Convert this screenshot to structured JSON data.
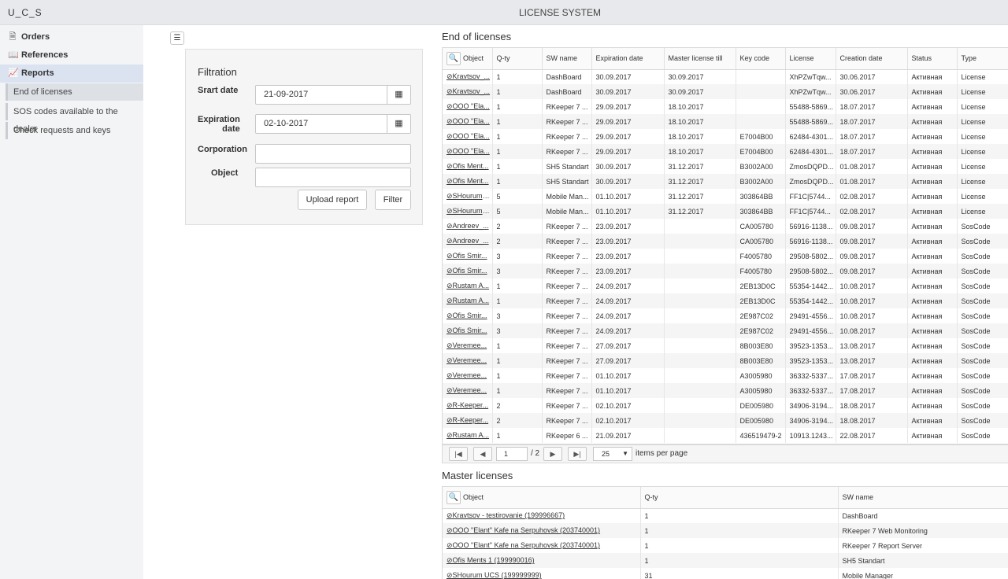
{
  "header": {
    "brand": "U_C_S",
    "title": "LICENSE SYSTEM"
  },
  "sidebar": {
    "items": [
      {
        "label": "Orders",
        "icon": "document-icon",
        "glyph": "🗎"
      },
      {
        "label": "References",
        "icon": "book-icon",
        "glyph": "📖"
      },
      {
        "label": "Reports",
        "icon": "chart-line-icon",
        "glyph": "📈"
      }
    ],
    "subitems": [
      {
        "label": "End of licenses"
      },
      {
        "label": "SOS codes available to the dealer"
      },
      {
        "label": "Check requests and keys"
      }
    ]
  },
  "filter": {
    "title": "Filtration",
    "start_label": "Srart date",
    "start_value": "21-09-2017",
    "exp_label_1": "Expiration",
    "exp_label_2": "date",
    "exp_value": "02-10-2017",
    "corp_label": "Corporation",
    "corp_value": "",
    "object_label": "Object",
    "object_value": "",
    "upload_label": "Upload report",
    "filter_label": "Filter"
  },
  "end_licenses": {
    "title": "End of licenses",
    "columns": [
      "Object",
      "Q-ty",
      "SW name",
      "Expiration date",
      "Master license till",
      "Key code",
      "License",
      "Creation date",
      "Status",
      "Type"
    ],
    "rows": [
      [
        "⊘Kravtsov_...",
        "1",
        "DashBoard",
        "30.09.2017",
        "30.09.2017",
        "",
        "XhPZwTqw...",
        "30.06.2017",
        "Активная",
        "License"
      ],
      [
        "⊘Kravtsov_...",
        "1",
        "DashBoard",
        "30.09.2017",
        "30.09.2017",
        "",
        "XhPZwTqw...",
        "30.06.2017",
        "Активная",
        "License"
      ],
      [
        "⊘OOO \"Ela...",
        "1",
        "RKeeper 7 ...",
        "29.09.2017",
        "18.10.2017",
        "",
        "55488-5869...",
        "18.07.2017",
        "Активная",
        "License"
      ],
      [
        "⊘OOO \"Ela...",
        "1",
        "RKeeper 7 ...",
        "29.09.2017",
        "18.10.2017",
        "",
        "55488-5869...",
        "18.07.2017",
        "Активная",
        "License"
      ],
      [
        "⊘OOO \"Ela...",
        "1",
        "RKeeper 7 ...",
        "29.09.2017",
        "18.10.2017",
        "E7004B00",
        "62484-4301...",
        "18.07.2017",
        "Активная",
        "License"
      ],
      [
        "⊘OOO \"Ela...",
        "1",
        "RKeeper 7 ...",
        "29.09.2017",
        "18.10.2017",
        "E7004B00",
        "62484-4301...",
        "18.07.2017",
        "Активная",
        "License"
      ],
      [
        "⊘Ofis Ment...",
        "1",
        "SH5 Standart",
        "30.09.2017",
        "31.12.2017",
        "B3002A00",
        "ZmosDQPD...",
        "01.08.2017",
        "Активная",
        "License"
      ],
      [
        "⊘Ofis Ment...",
        "1",
        "SH5 Standart",
        "30.09.2017",
        "31.12.2017",
        "B3002A00",
        "ZmosDQPD...",
        "01.08.2017",
        "Активная",
        "License"
      ],
      [
        "⊘SHourum_...",
        "5",
        "Mobile Man...",
        "01.10.2017",
        "31.12.2017",
        "303864BB",
        "FF1C|5744...",
        "02.08.2017",
        "Активная",
        "License"
      ],
      [
        "⊘SHourum_...",
        "5",
        "Mobile Man...",
        "01.10.2017",
        "31.12.2017",
        "303864BB",
        "FF1C|5744...",
        "02.08.2017",
        "Активная",
        "License"
      ],
      [
        "⊘Andreev_...",
        "2",
        "RKeeper 7 ...",
        "23.09.2017",
        "",
        "CA005780",
        "56916-1138...",
        "09.08.2017",
        "Активная",
        "SosCode"
      ],
      [
        "⊘Andreev_...",
        "2",
        "RKeeper 7 ...",
        "23.09.2017",
        "",
        "CA005780",
        "56916-1138...",
        "09.08.2017",
        "Активная",
        "SosCode"
      ],
      [
        "⊘Ofis Smir...",
        "3",
        "RKeeper 7 ...",
        "23.09.2017",
        "",
        "F4005780",
        "29508-5802...",
        "09.08.2017",
        "Активная",
        "SosCode"
      ],
      [
        "⊘Ofis Smir...",
        "3",
        "RKeeper 7 ...",
        "23.09.2017",
        "",
        "F4005780",
        "29508-5802...",
        "09.08.2017",
        "Активная",
        "SosCode"
      ],
      [
        "⊘Rustam A...",
        "1",
        "RKeeper 7 ...",
        "24.09.2017",
        "",
        "2EB13D0C",
        "55354-1442...",
        "10.08.2017",
        "Активная",
        "SosCode"
      ],
      [
        "⊘Rustam A...",
        "1",
        "RKeeper 7 ...",
        "24.09.2017",
        "",
        "2EB13D0C",
        "55354-1442...",
        "10.08.2017",
        "Активная",
        "SosCode"
      ],
      [
        "⊘Ofis Smir...",
        "3",
        "RKeeper 7 ...",
        "24.09.2017",
        "",
        "2E987C02",
        "29491-4556...",
        "10.08.2017",
        "Активная",
        "SosCode"
      ],
      [
        "⊘Ofis Smir...",
        "3",
        "RKeeper 7 ...",
        "24.09.2017",
        "",
        "2E987C02",
        "29491-4556...",
        "10.08.2017",
        "Активная",
        "SosCode"
      ],
      [
        "⊘Veremee...",
        "1",
        "RKeeper 7 ...",
        "27.09.2017",
        "",
        "8B003E80",
        "39523-1353...",
        "13.08.2017",
        "Активная",
        "SosCode"
      ],
      [
        "⊘Veremee...",
        "1",
        "RKeeper 7 ...",
        "27.09.2017",
        "",
        "8B003E80",
        "39523-1353...",
        "13.08.2017",
        "Активная",
        "SosCode"
      ],
      [
        "⊘Veremee...",
        "1",
        "RKeeper 7 ...",
        "01.10.2017",
        "",
        "A3005980",
        "36332-5337...",
        "17.08.2017",
        "Активная",
        "SosCode"
      ],
      [
        "⊘Veremee...",
        "1",
        "RKeeper 7 ...",
        "01.10.2017",
        "",
        "A3005980",
        "36332-5337...",
        "17.08.2017",
        "Активная",
        "SosCode"
      ],
      [
        "⊘R-Keeper...",
        "2",
        "RKeeper 7 ...",
        "02.10.2017",
        "",
        "DE005980",
        "34906-3194...",
        "18.08.2017",
        "Активная",
        "SosCode"
      ],
      [
        "⊘R-Keeper...",
        "2",
        "RKeeper 7 ...",
        "02.10.2017",
        "",
        "DE005980",
        "34906-3194...",
        "18.08.2017",
        "Активная",
        "SosCode"
      ],
      [
        "⊘Rustam A...",
        "1",
        "RKeeper 6 ...",
        "21.09.2017",
        "",
        "436519479-2",
        "10913.1243...",
        "22.08.2017",
        "Активная",
        "SosCode"
      ]
    ],
    "pager": {
      "first_glyph": "|◀",
      "prev_glyph": "◀",
      "next_glyph": "▶",
      "last_glyph": "▶|",
      "page": "1",
      "of": "/ 2",
      "page_size": "25",
      "items_label": "items per page"
    }
  },
  "master_licenses": {
    "title": "Master licenses",
    "columns": [
      "Object",
      "Q-ty",
      "SW name"
    ],
    "rows": [
      [
        "⊘Kravtsov - testirovanie (199996667)",
        "1",
        "DashBoard"
      ],
      [
        "⊘OOO \"Elant\" Kafe na Serpuhovsk (203740001)",
        "1",
        "RKeeper 7 Web Monitoring"
      ],
      [
        "⊘OOO \"Elant\" Kafe na Serpuhovsk (203740001)",
        "1",
        "RKeeper 7 Report Server"
      ],
      [
        "⊘Ofis Ments 1 (199990016)",
        "1",
        "SH5 Standart"
      ],
      [
        "⊘SHourum UCS (199999999)",
        "31",
        "Mobile Manager"
      ]
    ]
  },
  "colors": {
    "topbar": "#e8e9ec",
    "sidebar": "#f3f4f6",
    "active_nav": "#dbe3f1",
    "row_alt": "#f5f5f5"
  }
}
